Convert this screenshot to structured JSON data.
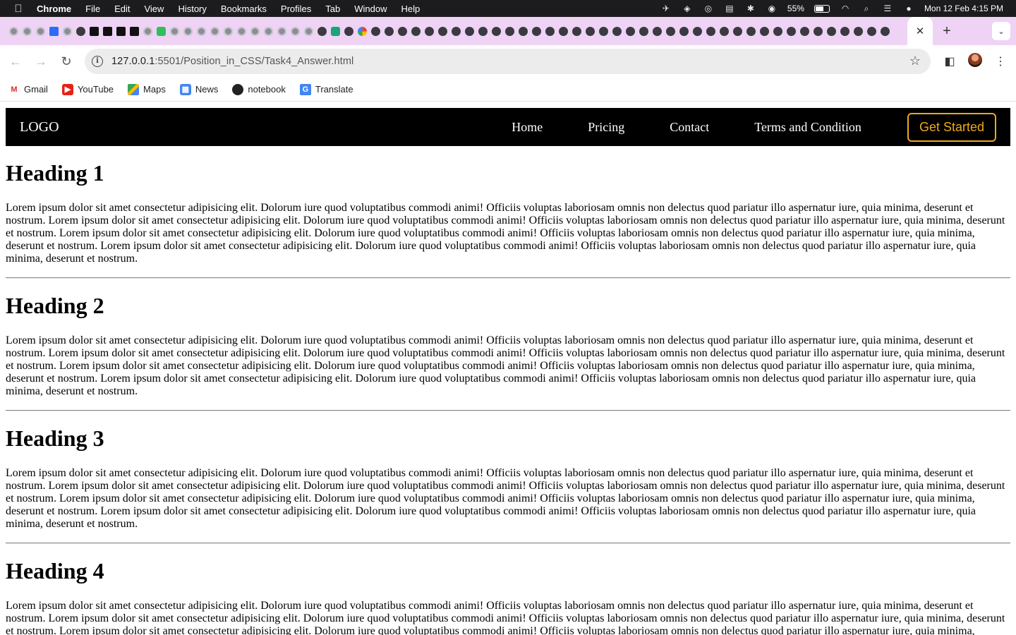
{
  "menubar": {
    "apple_icon": "apple-logo-icon",
    "app_name": "Chrome",
    "items": [
      "File",
      "Edit",
      "View",
      "History",
      "Bookmarks",
      "Profiles",
      "Tab",
      "Window",
      "Help"
    ],
    "battery_percent": "55%",
    "battery_level": 0.55,
    "datetime": "Mon 12 Feb  4:15 PM"
  },
  "browser": {
    "tab_close_symbol": "✕",
    "new_tab_symbol": "+",
    "url_host": "127.0.0.1",
    "url_rest": ":5501/Position_in_CSS/Task4_Answer.html",
    "bookmarks": [
      {
        "label": "Gmail",
        "icon": "gmail-icon"
      },
      {
        "label": "YouTube",
        "icon": "youtube-icon"
      },
      {
        "label": "Maps",
        "icon": "maps-icon"
      },
      {
        "label": "News",
        "icon": "news-icon"
      },
      {
        "label": "notebook",
        "icon": "notebook-icon"
      },
      {
        "label": "Translate",
        "icon": "translate-icon"
      }
    ]
  },
  "site": {
    "logo": "LOGO",
    "nav": [
      "Home",
      "Pricing",
      "Contact",
      "Terms and Condition"
    ],
    "cta": "Get Started",
    "accent_color": "#f0a81a",
    "sections": [
      {
        "heading": "Heading 1",
        "text": "Lorem ipsum dolor sit amet consectetur adipisicing elit. Dolorum iure quod voluptatibus commodi animi! Officiis voluptas laboriosam omnis non delectus quod pariatur illo aspernatur iure, quia minima, deserunt et nostrum. Lorem ipsum dolor sit amet consectetur adipisicing elit. Dolorum iure quod voluptatibus commodi animi! Officiis voluptas laboriosam omnis non delectus quod pariatur illo aspernatur iure, quia minima, deserunt et nostrum. Lorem ipsum dolor sit amet consectetur adipisicing elit. Dolorum iure quod voluptatibus commodi animi! Officiis voluptas laboriosam omnis non delectus quod pariatur illo aspernatur iure, quia minima, deserunt et nostrum. Lorem ipsum dolor sit amet consectetur adipisicing elit. Dolorum iure quod voluptatibus commodi animi! Officiis voluptas laboriosam omnis non delectus quod pariatur illo aspernatur iure, quia minima, deserunt et nostrum."
      },
      {
        "heading": "Heading 2",
        "text": "Lorem ipsum dolor sit amet consectetur adipisicing elit. Dolorum iure quod voluptatibus commodi animi! Officiis voluptas laboriosam omnis non delectus quod pariatur illo aspernatur iure, quia minima, deserunt et nostrum. Lorem ipsum dolor sit amet consectetur adipisicing elit. Dolorum iure quod voluptatibus commodi animi! Officiis voluptas laboriosam omnis non delectus quod pariatur illo aspernatur iure, quia minima, deserunt et nostrum. Lorem ipsum dolor sit amet consectetur adipisicing elit. Dolorum iure quod voluptatibus commodi animi! Officiis voluptas laboriosam omnis non delectus quod pariatur illo aspernatur iure, quia minima, deserunt et nostrum. Lorem ipsum dolor sit amet consectetur adipisicing elit. Dolorum iure quod voluptatibus commodi animi! Officiis voluptas laboriosam omnis non delectus quod pariatur illo aspernatur iure, quia minima, deserunt et nostrum."
      },
      {
        "heading": "Heading 3",
        "text": "Lorem ipsum dolor sit amet consectetur adipisicing elit. Dolorum iure quod voluptatibus commodi animi! Officiis voluptas laboriosam omnis non delectus quod pariatur illo aspernatur iure, quia minima, deserunt et nostrum. Lorem ipsum dolor sit amet consectetur adipisicing elit. Dolorum iure quod voluptatibus commodi animi! Officiis voluptas laboriosam omnis non delectus quod pariatur illo aspernatur iure, quia minima, deserunt et nostrum. Lorem ipsum dolor sit amet consectetur adipisicing elit. Dolorum iure quod voluptatibus commodi animi! Officiis voluptas laboriosam omnis non delectus quod pariatur illo aspernatur iure, quia minima, deserunt et nostrum. Lorem ipsum dolor sit amet consectetur adipisicing elit. Dolorum iure quod voluptatibus commodi animi! Officiis voluptas laboriosam omnis non delectus quod pariatur illo aspernatur iure, quia minima, deserunt et nostrum."
      },
      {
        "heading": "Heading 4",
        "text": "Lorem ipsum dolor sit amet consectetur adipisicing elit. Dolorum iure quod voluptatibus commodi animi! Officiis voluptas laboriosam omnis non delectus quod pariatur illo aspernatur iure, quia minima, deserunt et nostrum. Lorem ipsum dolor sit amet consectetur adipisicing elit. Dolorum iure quod voluptatibus commodi animi! Officiis voluptas laboriosam omnis non delectus quod pariatur illo aspernatur iure, quia minima, deserunt et nostrum. Lorem ipsum dolor sit amet consectetur adipisicing elit. Dolorum iure quod voluptatibus commodi animi! Officiis voluptas laboriosam omnis non delectus quod pariatur illo aspernatur iure, quia minima, deserunt et nostrum."
      }
    ]
  }
}
